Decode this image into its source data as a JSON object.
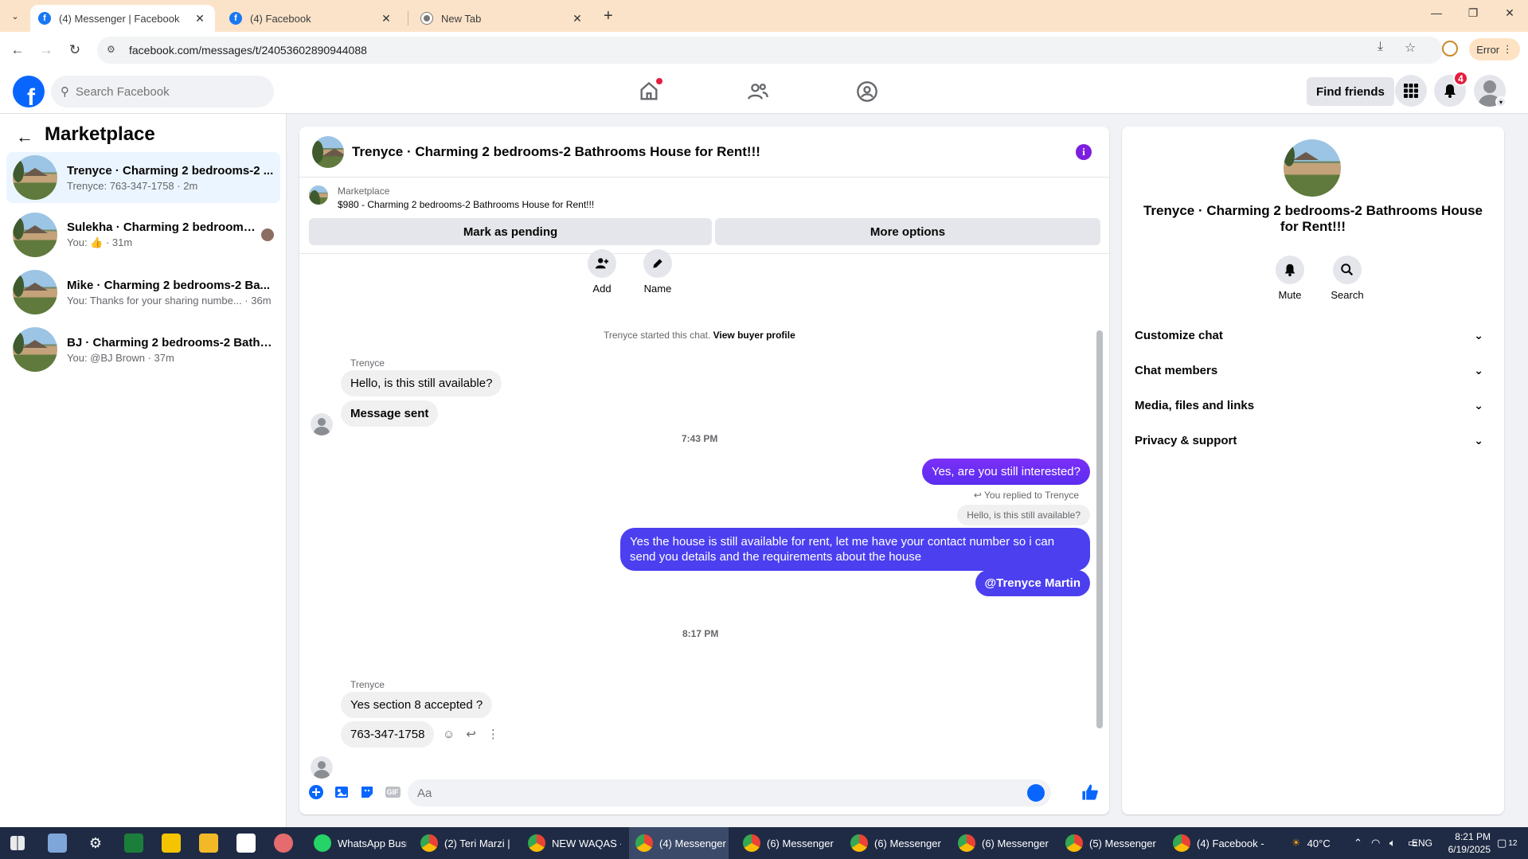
{
  "browser": {
    "tabs": [
      {
        "title": "(4) Messenger | Facebook",
        "active": true
      },
      {
        "title": "(4) Facebook",
        "active": false
      },
      {
        "title": "New Tab",
        "active": false
      }
    ],
    "url": "facebook.com/messages/t/24053602890944088",
    "error_label": "Error"
  },
  "fb_header": {
    "search_placeholder": "Search Facebook",
    "find_friends": "Find friends",
    "notification_count": "4"
  },
  "sidebar": {
    "title": "Marketplace",
    "conversations": [
      {
        "name": "Trenyce · Charming 2 bedrooms-2 ...",
        "preview": "Trenyce: 763-347-1758 · 2m",
        "active": true
      },
      {
        "name": "Sulekha · Charming 2 bedrooms...",
        "preview": "You: 👍 · 31m",
        "active": false
      },
      {
        "name": "Mike · Charming 2 bedrooms-2 Ba...",
        "preview": "You: Thanks for your sharing numbe... · 36m",
        "active": false
      },
      {
        "name": "BJ · Charming 2 bedrooms-2 Bathr...",
        "preview": "You: @BJ Brown · 37m",
        "active": false
      }
    ]
  },
  "chat": {
    "title": "Trenyce · Charming 2 bedrooms-2 Bathrooms House for Rent!!!",
    "marketplace_label": "Marketplace",
    "listing": "$980 - Charming 2 bedrooms-2 Bathrooms House for Rent!!!",
    "mark_pending": "Mark as pending",
    "more_options": "More options",
    "top_actions": {
      "add": "Add",
      "name": "Name"
    },
    "started_text": "Trenyce started this chat.",
    "view_buyer": "View buyer profile",
    "sender1": "Trenyce",
    "msg_in_1": "Hello, is this still available?",
    "msg_in_2": "Message sent",
    "time1": "7:43 PM",
    "msg_out_1": "Yes, are you still interested?",
    "reply_hint": "You replied to Trenyce",
    "quoted": "Hello, is this still available?",
    "msg_out_2": "Yes the house is still available for rent, let me have your contact number so i can send you details and the requirements about the house",
    "msg_out_3": "@Trenyce Martin",
    "time2": "8:17 PM",
    "sender2": "Trenyce",
    "msg_in_3": "Yes section 8 accepted ?",
    "msg_in_4": "763-347-1758",
    "composer_placeholder": "Aa",
    "composer_gif": "GIF"
  },
  "right_panel": {
    "title": "Trenyce · Charming 2 bedrooms-2 Bathrooms House for Rent!!!",
    "mute": "Mute",
    "search": "Search",
    "sections": [
      "Customize chat",
      "Chat members",
      "Media, files and links",
      "Privacy & support"
    ]
  },
  "taskbar": {
    "apps": [
      {
        "label": "WhatsApp Busi...",
        "active": false
      },
      {
        "label": "(2) Teri Marzi | ...",
        "active": false
      },
      {
        "label": "NEW WAQAS - ...",
        "active": false
      },
      {
        "label": "(4) Messenger ...",
        "active": true
      },
      {
        "label": "(6) Messenger ...",
        "active": false
      },
      {
        "label": "(6) Messenger ...",
        "active": false
      },
      {
        "label": "(6) Messenger ...",
        "active": false
      },
      {
        "label": "(5) Messenger ...",
        "active": false
      },
      {
        "label": "(4) Facebook - ...",
        "active": false
      }
    ],
    "weather": "40°C",
    "lang": "ENG",
    "time": "8:21 PM",
    "date": "6/19/2025",
    "notif_count": "12"
  }
}
